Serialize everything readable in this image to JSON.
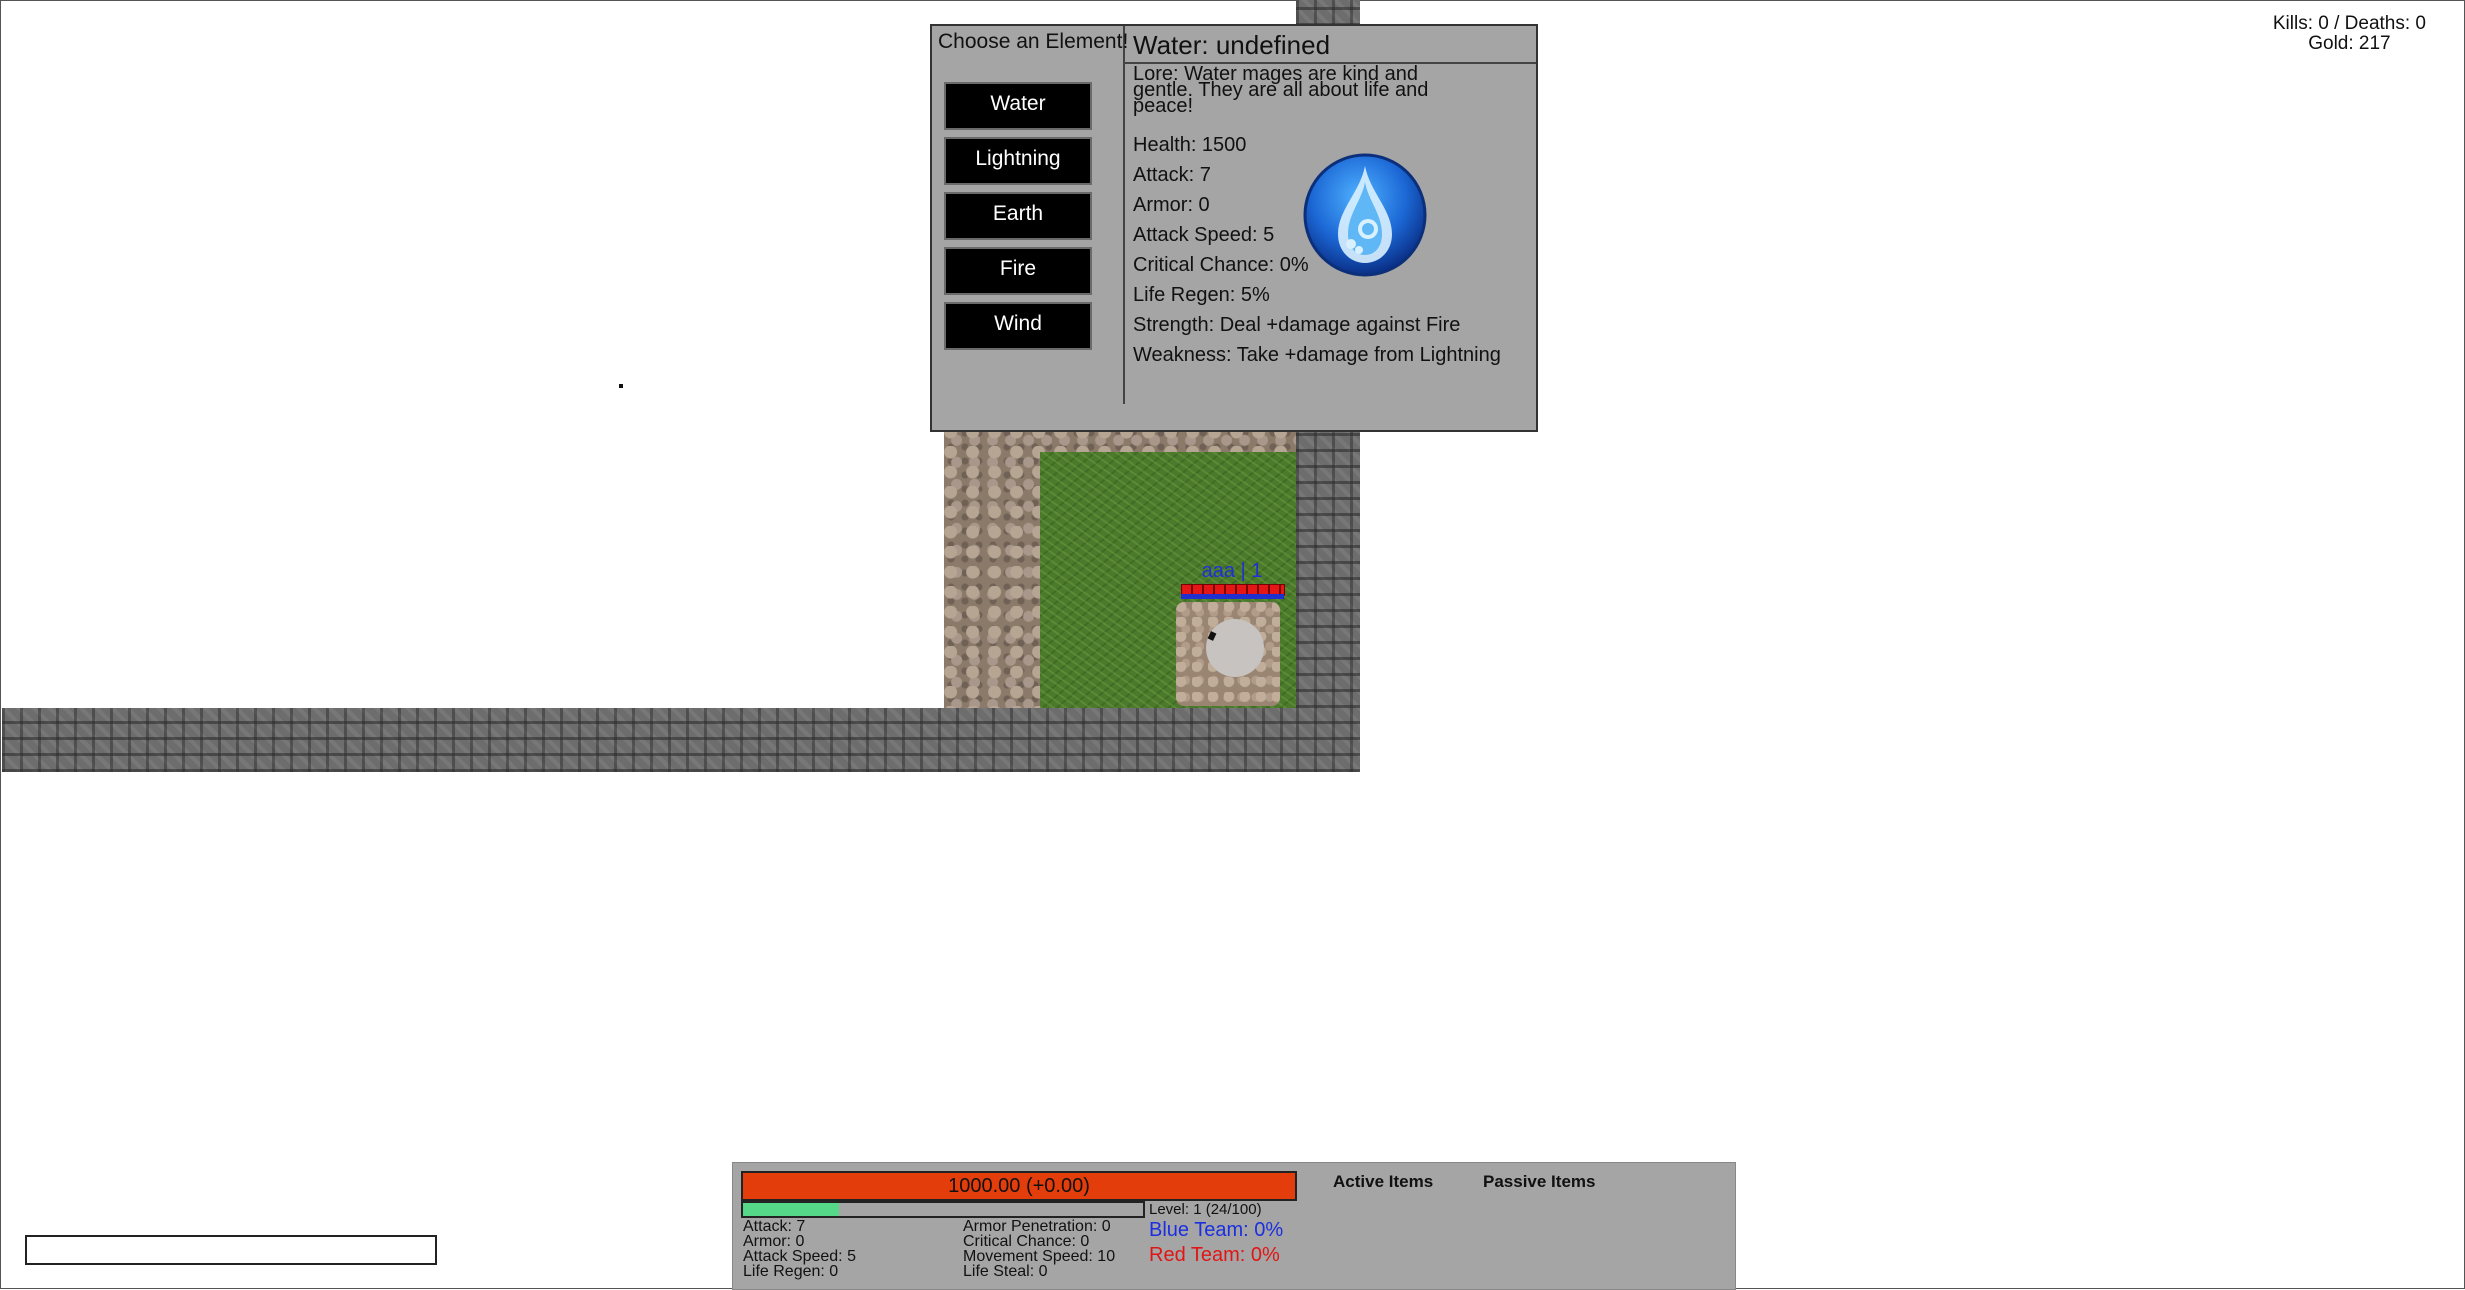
{
  "score": {
    "kills_deaths": "Kills: 0 / Deaths: 0",
    "gold": "Gold: 217"
  },
  "player": {
    "name": "aaa | 1"
  },
  "modal": {
    "choose_title": "Choose an Element!",
    "elements": [
      "Water",
      "Lightning",
      "Earth",
      "Fire",
      "Wind"
    ],
    "detail": {
      "title": "Water: undefined",
      "lore": "Lore: Water mages are kind and gentle. They are all about life and peace!",
      "health": "Health: 1500",
      "attack": "Attack: 7",
      "armor": "Armor: 0",
      "attack_speed": "Attack Speed: 5",
      "critical_chance": "Critical Chance: 0%",
      "life_regen": "Life Regen: 5%",
      "strength": "Strength: Deal +damage against Fire",
      "weakness": "Weakness: Take +damage from Lightning",
      "icon": "water-drop-icon"
    }
  },
  "hud": {
    "health_text": "1000.00 (+0.00)",
    "xp_fraction": 0.24,
    "level": "Level: 1 (24/100)",
    "stats_left": [
      "Attack: 7",
      "Armor: 0",
      "Attack Speed: 5",
      "Life Regen: 0"
    ],
    "stats_right": [
      "Armor Penetration: 0",
      "Critical Chance: 0",
      "Movement Speed: 10",
      "Life Steal: 0"
    ],
    "blue_team": "Blue Team: 0%",
    "red_team": "Red Team: 0%",
    "active_items": "Active Items",
    "passive_items": "Passive Items"
  },
  "colors": {
    "health": "#e33d0c",
    "xp": "#55d888",
    "blue_team": "#1b2fe0",
    "red_team": "#e01616",
    "panel": "#a5a5a5"
  }
}
